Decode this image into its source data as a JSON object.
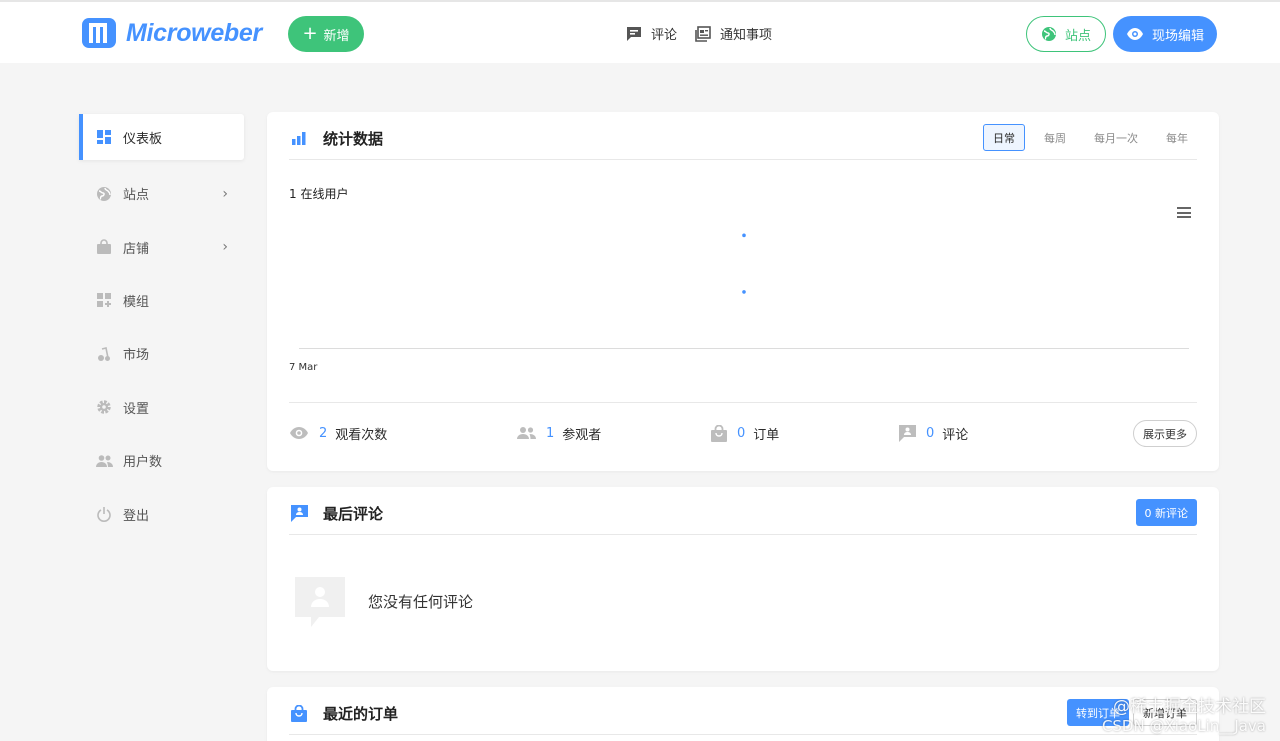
{
  "header": {
    "logo_text": "Microweber",
    "add_label": "新增",
    "nav": [
      {
        "label": "评论",
        "icon": "comment-icon"
      },
      {
        "label": "通知事项",
        "icon": "notifications-icon"
      }
    ],
    "site_label": "站点",
    "live_edit_label": "现场编辑"
  },
  "sidebar": {
    "items": [
      {
        "label": "仪表板",
        "icon": "dashboard-icon",
        "active": true
      },
      {
        "label": "站点",
        "icon": "globe-icon",
        "has_submenu": true
      },
      {
        "label": "店铺",
        "icon": "shop-icon",
        "has_submenu": true
      },
      {
        "label": "模组",
        "icon": "modules-icon"
      },
      {
        "label": "市场",
        "icon": "marketplace-icon"
      },
      {
        "label": "设置",
        "icon": "gear-icon"
      },
      {
        "label": "用户数",
        "icon": "users-icon"
      },
      {
        "label": "登出",
        "icon": "power-icon"
      }
    ]
  },
  "stats": {
    "title": "统计数据",
    "periods": [
      "日常",
      "每周",
      "每月一次",
      "每年"
    ],
    "active_period": "日常",
    "online_text": "1 在线用户",
    "summary": [
      {
        "value": "2",
        "label": "观看次数",
        "icon": "eye-icon"
      },
      {
        "value": "1",
        "label": "参观者",
        "icon": "visitors-icon"
      },
      {
        "value": "0",
        "label": "订单",
        "icon": "shopping-bag-icon"
      },
      {
        "value": "0",
        "label": "评论",
        "icon": "comment-icon"
      }
    ],
    "show_more_label": "展示更多"
  },
  "chart_data": {
    "type": "line",
    "categories": [
      "7 Mar"
    ],
    "series": [
      {
        "values": [
          2
        ]
      },
      {
        "values": [
          1
        ]
      }
    ],
    "ylim": [
      0,
      2.2
    ]
  },
  "comments": {
    "title": "最后评论",
    "badge_label": "0 新评论",
    "empty_text": "您没有任何评论"
  },
  "orders": {
    "title": "最近的订单",
    "button_primary": "转到订单",
    "button_secondary": "新增订单"
  },
  "watermark": {
    "line1": "@稀土掘金技术社区",
    "line2": "CSDN @XiaoLin__Java"
  },
  "colors": {
    "accent": "#4592ff",
    "green": "#3ec47a",
    "background": "#f5f5f5"
  }
}
